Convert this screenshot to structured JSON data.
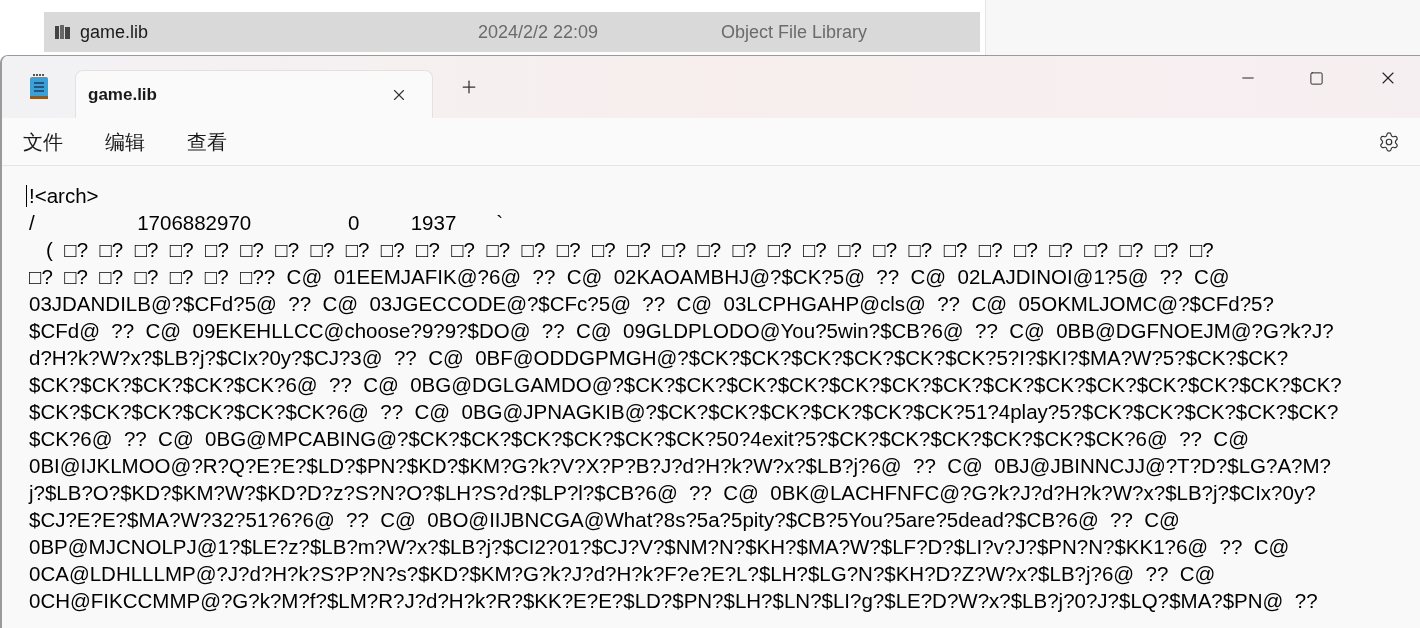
{
  "background_window": {
    "file_row": {
      "name": "game.lib",
      "modified": "2024/2/2 22:09",
      "type": "Object File Library",
      "selected": true
    }
  },
  "window": {
    "tabs": [
      {
        "label": "game.lib",
        "selected": true
      }
    ],
    "menu": [
      "文件",
      "编辑",
      "查看"
    ]
  },
  "editor": {
    "lines": [
      "!<arch>",
      "/                  1706882970                 0         1937       `",
      "   (  □?  □?  □?  □?  □?  □?  □?  □?  □?  □?  □?  □?  □?  □?  □?  □?  □?  □?  □?  □?  □?  □?  □?  □?  □?  □?  □?  □?  □?  □?  □?  □?  □?",
      "□?  □?  □?  □?  □?  □?  □??  C@  01EEMJAFIK@?6@  ??  C@  02KAOAMBHJ@?$CK?5@  ??  C@  02LAJDINOI@1?5@  ??  C@",
      "03JDANDILB@?$CFd?5@  ??  C@  03JGECCODE@?$CFc?5@  ??  C@  03LCPHGAHP@cls@  ??  C@  05OKMLJOMC@?$CFd?5?",
      "$CFd@  ??  C@  09EKEHLLCC@choose?9?9?$DO@  ??  C@  09GLDPLODO@You?5win?$CB?6@  ??  C@  0BB@DGFNOEJM@?G?k?J?",
      "d?H?k?W?x?$LB?j?$CIx?0y?$CJ?3@  ??  C@  0BF@ODDGPMGH@?$CK?$CK?$CK?$CK?$CK?$CK?5?I?$KI?$MA?W?5?$CK?$CK?",
      "$CK?$CK?$CK?$CK?$CK?6@  ??  C@  0BG@DGLGAMDO@?$CK?$CK?$CK?$CK?$CK?$CK?$CK?$CK?$CK?$CK?$CK?$CK?$CK?$CK?",
      "$CK?$CK?$CK?$CK?$CK?$CK?6@  ??  C@  0BG@JPNAGKIB@?$CK?$CK?$CK?$CK?$CK?$CK?51?4play?5?$CK?$CK?$CK?$CK?$CK?",
      "$CK?6@  ??  C@  0BG@MPCABING@?$CK?$CK?$CK?$CK?$CK?$CK?50?4exit?5?$CK?$CK?$CK?$CK?$CK?$CK?6@  ??  C@",
      "0BI@IJKLMOO@?R?Q?E?E?$LD?$PN?$KD?$KM?G?k?V?X?P?B?J?d?H?k?W?x?$LB?j?6@  ??  C@  0BJ@JBINNCJJ@?T?D?$LG?A?M?",
      "j?$LB?O?$KD?$KM?W?$KD?D?z?S?N?O?$LH?S?d?$LP?l?$CB?6@  ??  C@  0BK@LACHFNFC@?G?k?J?d?H?k?W?x?$LB?j?$CIx?0y?",
      "$CJ?E?E?$MA?W?32?51?6?6@  ??  C@  0BO@IIJBNCGA@What?8s?5a?5pity?$CB?5You?5are?5dead?$CB?6@  ??  C@",
      "0BP@MJCNOLPJ@1?$LE?z?$LB?m?W?x?$LB?j?$CI2?01?$CJ?V?$NM?N?$KH?$MA?W?$LF?D?$LI?v?J?$PN?N?$KK1?6@  ??  C@",
      "0CA@LDHLLLMP@?J?d?H?k?S?P?N?s?$KD?$KM?G?k?J?d?H?k?F?e?E?L?$LH?$LG?N?$KH?D?Z?W?x?$LB?j?6@  ??  C@",
      "0CH@FIKCCMMP@?G?k?M?f?$LM?R?J?d?H?k?R?$KK?E?E?$LD?$PN?$LH?$LN?$LI?g?$LE?D?W?x?$LB?j?0?J?$LQ?$MA?$PN@  ??"
    ]
  }
}
